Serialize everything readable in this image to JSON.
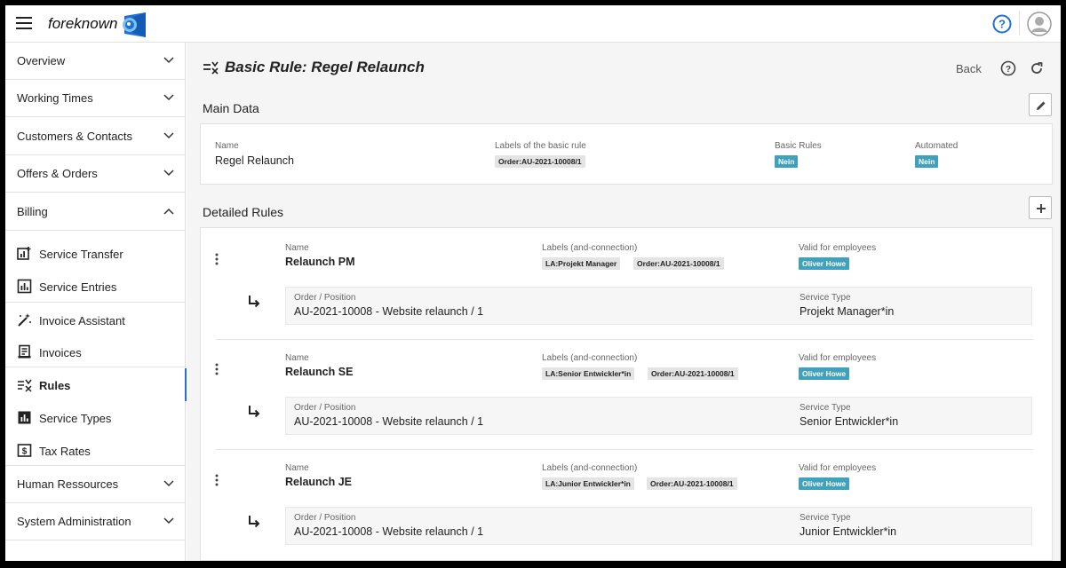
{
  "app": {
    "name": "foreknown"
  },
  "colors": {
    "accent": "#2a6dd6",
    "badge": "#3fa1bb",
    "tag": "#e4e4e4"
  },
  "sidebar": {
    "groups": [
      {
        "label": "Overview",
        "state": "collapsed"
      },
      {
        "label": "Working Times",
        "state": "collapsed"
      },
      {
        "label": "Customers & Contacts",
        "state": "collapsed"
      },
      {
        "label": "Offers & Orders",
        "state": "collapsed"
      },
      {
        "label": "Billing",
        "state": "expanded"
      },
      {
        "label": "Human Ressources",
        "state": "collapsed"
      },
      {
        "label": "System Administration",
        "state": "collapsed"
      }
    ],
    "billing_items": [
      {
        "label": "Service Transfer",
        "icon": "chart-plus-icon"
      },
      {
        "label": "Service Entries",
        "icon": "bar-chart-icon"
      },
      {
        "label": "Invoice Assistant",
        "icon": "magic-wand-icon"
      },
      {
        "label": "Invoices",
        "icon": "receipt-icon"
      },
      {
        "label": "Rules",
        "icon": "rules-icon",
        "active": true
      },
      {
        "label": "Service Types",
        "icon": "bar-chart-icon"
      },
      {
        "label": "Tax Rates",
        "icon": "dollar-icon"
      }
    ]
  },
  "header": {
    "title": "Basic Rule: Regel Relaunch",
    "back_label": "Back"
  },
  "main_data": {
    "title": "Main Data",
    "name_label": "Name",
    "name_value": "Regel Relaunch",
    "labels_label": "Labels of the basic rule",
    "labels": [
      "Order:AU-2021-10008/1"
    ],
    "basic_rules_label": "Basic Rules",
    "basic_rules_value": "Nein",
    "automated_label": "Automated",
    "automated_value": "Nein"
  },
  "detailed": {
    "title": "Detailed Rules",
    "name_label": "Name",
    "labels_label": "Labels (and-connection)",
    "valid_label": "Valid for employees",
    "order_label": "Order / Position",
    "service_type_label": "Service Type",
    "rules": [
      {
        "name": "Relaunch PM",
        "labels": [
          "LA:Projekt Manager",
          "Order:AU-2021-10008/1"
        ],
        "employee": "Oliver Howe",
        "order": "AU-2021-10008 - Website relaunch / 1",
        "service_type": "Projekt Manager*in"
      },
      {
        "name": "Relaunch SE",
        "labels": [
          "LA:Senior Entwickler*in",
          "Order:AU-2021-10008/1"
        ],
        "employee": "Oliver Howe",
        "order": "AU-2021-10008 - Website relaunch / 1",
        "service_type": "Senior Entwickler*in"
      },
      {
        "name": "Relaunch JE",
        "labels": [
          "LA:Junior Entwickler*in",
          "Order:AU-2021-10008/1"
        ],
        "employee": "Oliver Howe",
        "order": "AU-2021-10008 - Website relaunch / 1",
        "service_type": "Junior Entwickler*in"
      }
    ]
  }
}
